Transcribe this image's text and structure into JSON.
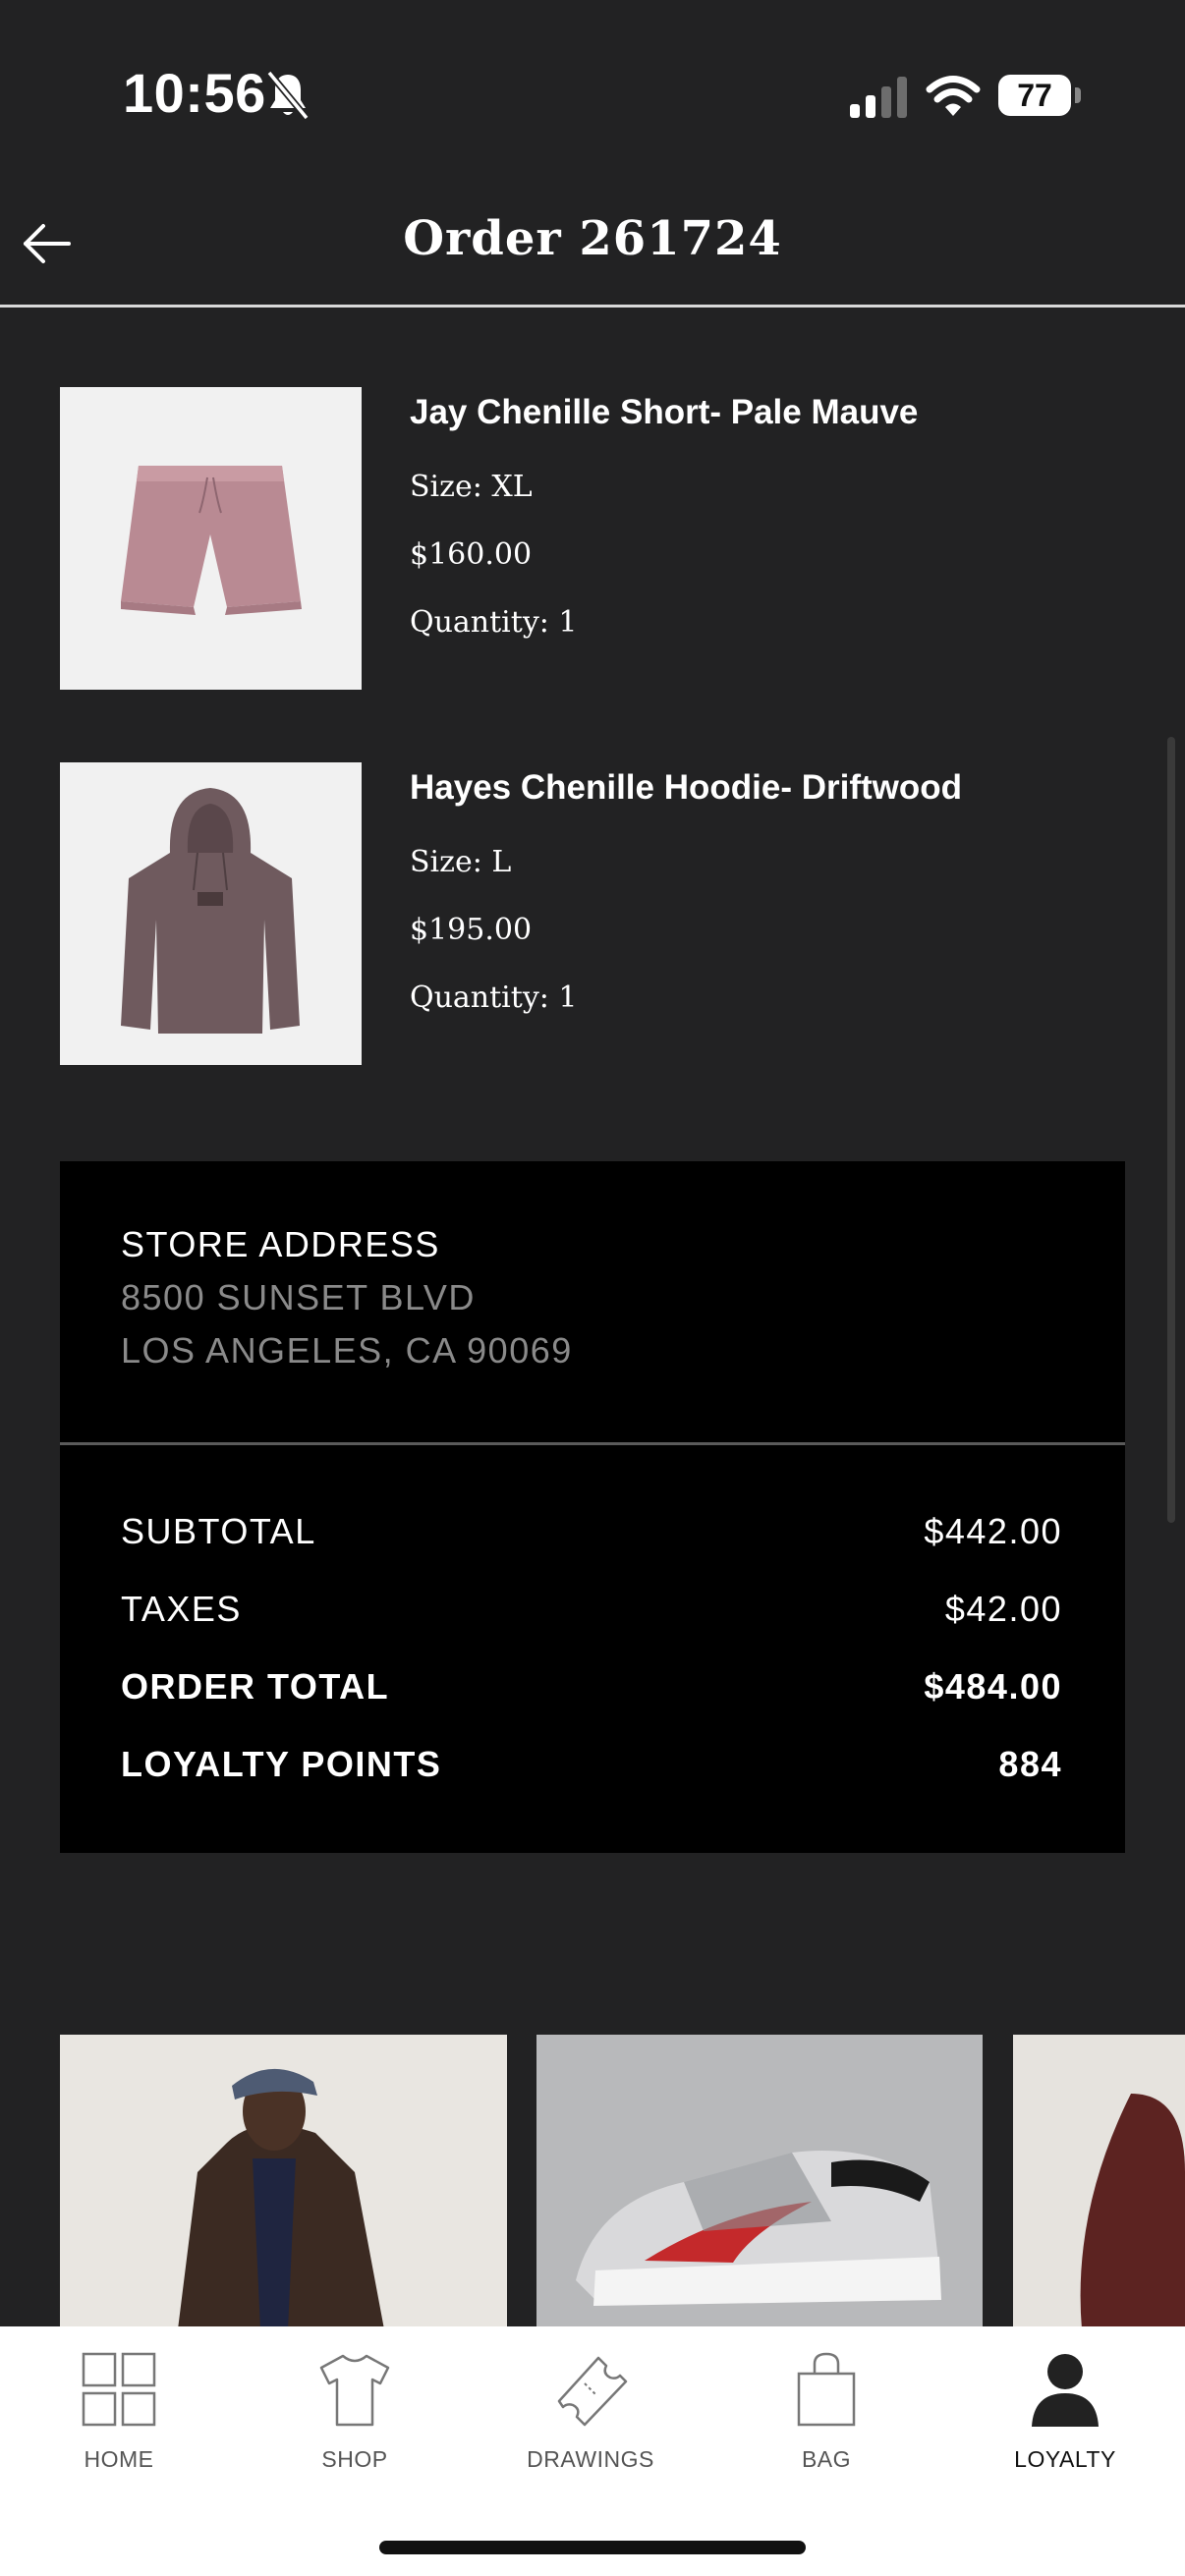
{
  "status_bar": {
    "time": "10:56",
    "battery": "77"
  },
  "header": {
    "title": "Order 261724"
  },
  "items": [
    {
      "name": "Jay Chenille Short- Pale Mauve",
      "size": "Size: XL",
      "price": "$160.00",
      "quantity": "Quantity: 1",
      "image": "pale-mauve-shorts"
    },
    {
      "name": "Hayes Chenille Hoodie- Driftwood",
      "size": "Size: L",
      "price": "$195.00",
      "quantity": "Quantity: 1",
      "image": "driftwood-hoodie"
    }
  ],
  "store": {
    "label": "STORE ADDRESS",
    "line1": "8500 SUNSET BLVD",
    "line2": "LOS ANGELES, CA 90069"
  },
  "totals": {
    "subtotal_label": "SUBTOTAL",
    "subtotal": "$442.00",
    "taxes_label": "TAXES",
    "taxes": "$42.00",
    "total_label": "ORDER TOTAL",
    "total": "$484.00",
    "points_label": "LOYALTY POINTS",
    "points": "884"
  },
  "carousel": [
    {
      "image": "model-in-brown-jacket-and-cap"
    },
    {
      "image": "grey-red-sneaker"
    },
    {
      "image": "burgundy-knit-partial"
    }
  ],
  "tabbar": {
    "home": "HOME",
    "shop": "SHOP",
    "drawings": "DRAWINGS",
    "bag": "BAG",
    "loyalty": "LOYALTY",
    "active": "loyalty"
  },
  "colors": {
    "background": "#222223",
    "summary_panel": "#000000",
    "tabbar": "#ffffff"
  }
}
